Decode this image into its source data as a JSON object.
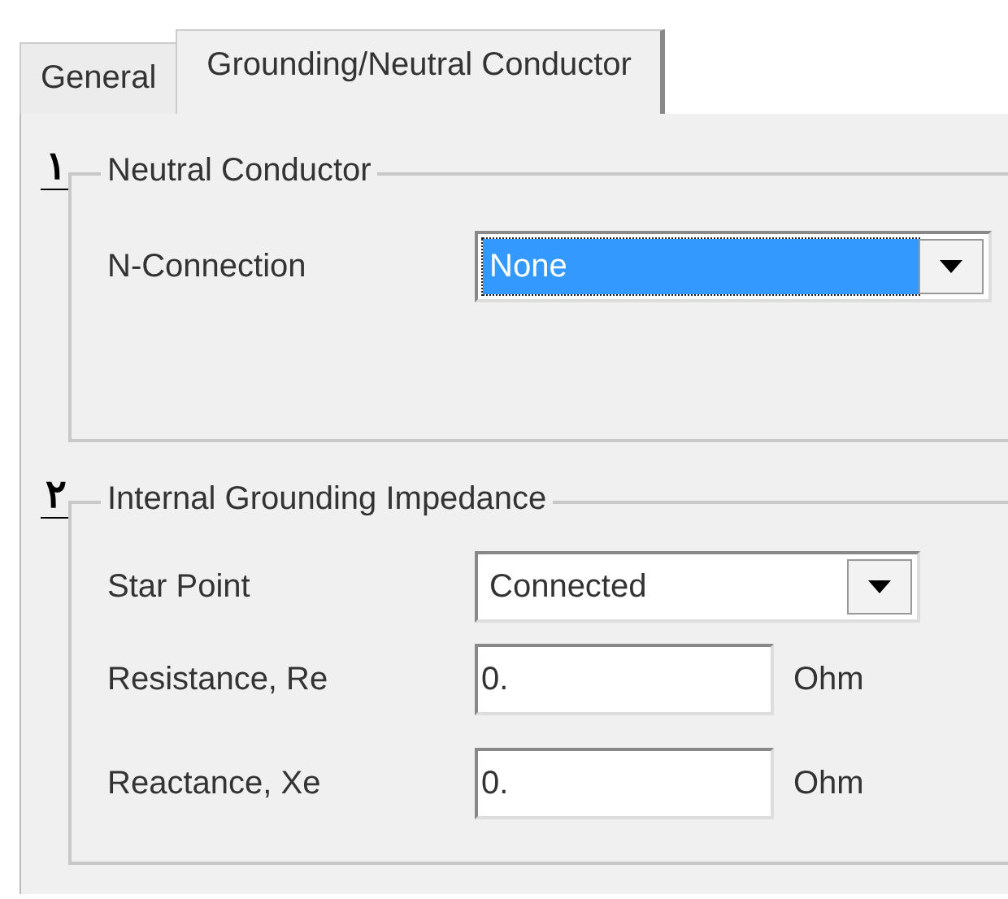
{
  "tabs": [
    {
      "label": "General",
      "selected": false
    },
    {
      "label": "Grounding/Neutral Conductor",
      "selected": true
    }
  ],
  "groups": [
    {
      "callout": "۱",
      "title": "Neutral Conductor",
      "rows": [
        {
          "kind": "dropdown",
          "label": "N-Connection",
          "value": "None",
          "highlighted": true
        }
      ]
    },
    {
      "callout": "۲",
      "title": "Internal Grounding Impedance",
      "rows": [
        {
          "kind": "dropdown",
          "label": "Star Point",
          "value": "Connected",
          "highlighted": false
        },
        {
          "kind": "field",
          "label": "Resistance, Re",
          "value": "0.",
          "unit": "Ohm"
        },
        {
          "kind": "field",
          "label": "Reactance, Xe",
          "value": "0.",
          "unit": "Ohm"
        }
      ]
    }
  ]
}
